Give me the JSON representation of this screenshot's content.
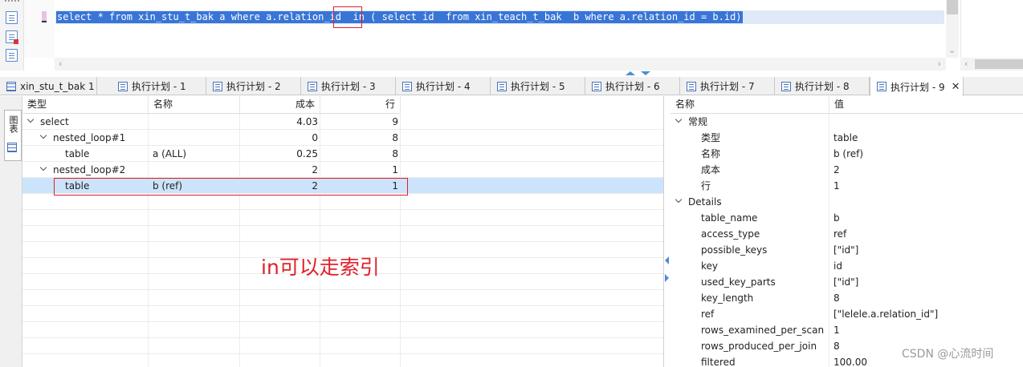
{
  "editor": {
    "sql_prefix": "select * from xin_stu_t_bak a where a.relation_id  ",
    "sql_in": "in",
    "sql_suffix": " ( select id  from xin_teach_t_bak  b where a.relation_id = b.id)"
  },
  "tabs": [
    {
      "label": "xin_stu_t_bak 1",
      "icon": "grid-icon"
    },
    {
      "label": "执行计划 - 1",
      "icon": "plan-icon"
    },
    {
      "label": "执行计划 - 2",
      "icon": "plan-icon"
    },
    {
      "label": "执行计划 - 3",
      "icon": "plan-icon"
    },
    {
      "label": "执行计划 - 4",
      "icon": "plan-icon"
    },
    {
      "label": "执行计划 - 5",
      "icon": "plan-icon"
    },
    {
      "label": "执行计划 - 6",
      "icon": "plan-icon"
    },
    {
      "label": "执行计划 - 7",
      "icon": "plan-icon"
    },
    {
      "label": "执行计划 - 8",
      "icon": "plan-icon"
    },
    {
      "label": "执行计划 - 9",
      "icon": "plan-icon",
      "active": true
    }
  ],
  "side_tab": {
    "label": "图表"
  },
  "plan": {
    "headers": {
      "type": "类型",
      "name": "名称",
      "cost": "成本",
      "rows": "行"
    },
    "rows": [
      {
        "type": "select",
        "name": "",
        "cost": "4.03",
        "rows": "9"
      },
      {
        "type": "nested_loop#1",
        "name": "",
        "cost": "0",
        "rows": "8"
      },
      {
        "type": "table",
        "name": "a (ALL)",
        "cost": "0.25",
        "rows": "8"
      },
      {
        "type": "nested_loop#2",
        "name": "",
        "cost": "2",
        "rows": "1"
      },
      {
        "type": "table",
        "name": "b (ref)",
        "cost": "2",
        "rows": "1"
      }
    ]
  },
  "annotation": "in可以走索引",
  "props": {
    "headers": {
      "name": "名称",
      "value": "值"
    },
    "group_general": "常规",
    "general": [
      {
        "name": "类型",
        "value": "table"
      },
      {
        "name": "名称",
        "value": "b (ref)"
      },
      {
        "name": "成本",
        "value": "2"
      },
      {
        "name": "行",
        "value": "1"
      }
    ],
    "group_details": "Details",
    "details": [
      {
        "name": "table_name",
        "value": "b"
      },
      {
        "name": "access_type",
        "value": "ref"
      },
      {
        "name": "possible_keys",
        "value": "[\"id\"]"
      },
      {
        "name": "key",
        "value": "id"
      },
      {
        "name": "used_key_parts",
        "value": "[\"id\"]"
      },
      {
        "name": "key_length",
        "value": "8"
      },
      {
        "name": "ref",
        "value": "[\"lelele.a.relation_id\"]"
      },
      {
        "name": "rows_examined_per_scan",
        "value": "1"
      },
      {
        "name": "rows_produced_per_join",
        "value": "8"
      },
      {
        "name": "filtered",
        "value": "100.00"
      }
    ]
  },
  "watermark": "CSDN @心流时间",
  "colors": {
    "selection": "#3875d7",
    "highlight_box": "#e0202a",
    "selected_row": "#cce4fb"
  }
}
